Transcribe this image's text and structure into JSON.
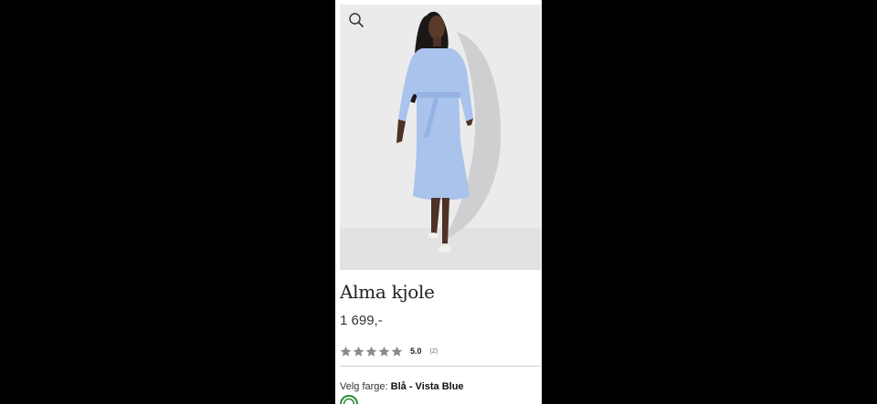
{
  "product": {
    "image_alt": "Alma kjole – model in light blue shirt dress",
    "title": "Alma kjole",
    "price": "1 699,-",
    "rating": {
      "stars": 5,
      "score": "5.0",
      "count": "(2)"
    },
    "color": {
      "label": "Velg farge:",
      "value": "Blå - Vista Blue"
    }
  },
  "icons": {
    "zoom": "search-icon",
    "star": "star-icon",
    "swatch": "color-swatch-icon"
  },
  "colors": {
    "background": "#000000",
    "panel": "#ffffff",
    "photo_bg": "#e9e9ea",
    "dress": "#a9c3ec",
    "star": "#8a8a8a",
    "swatch_ring": "#2e8b3a"
  }
}
